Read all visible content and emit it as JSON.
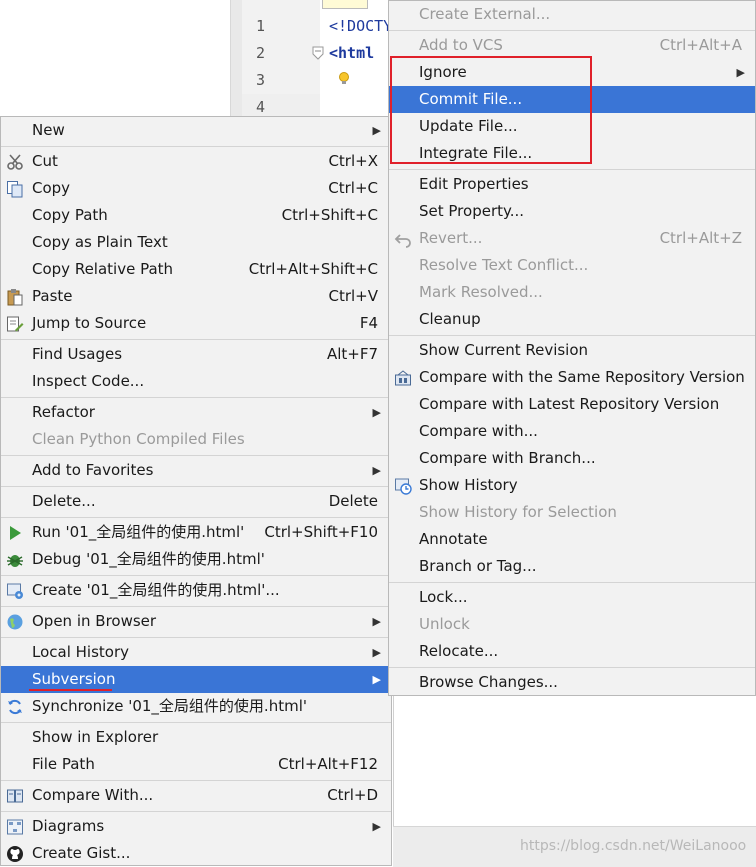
{
  "editor": {
    "line_numbers": [
      "1",
      "2",
      "3",
      "4"
    ],
    "code_lines": [
      "<!DOCTY",
      "<html"
    ]
  },
  "left_menu": {
    "new": "New",
    "cut": {
      "label": "Cut",
      "shortcut": "Ctrl+X"
    },
    "copy": {
      "label": "Copy",
      "shortcut": "Ctrl+C"
    },
    "copy_path": {
      "label": "Copy Path",
      "shortcut": "Ctrl+Shift+C"
    },
    "copy_plain": {
      "label": "Copy as Plain Text"
    },
    "copy_relative": {
      "label": "Copy Relative Path",
      "shortcut": "Ctrl+Alt+Shift+C"
    },
    "paste": {
      "label": "Paste",
      "shortcut": "Ctrl+V"
    },
    "jump": {
      "label": "Jump to Source",
      "shortcut": "F4"
    },
    "find_usages": {
      "label": "Find Usages",
      "shortcut": "Alt+F7"
    },
    "inspect": {
      "label": "Inspect Code..."
    },
    "refactor": {
      "label": "Refactor"
    },
    "clean_python": {
      "label": "Clean Python Compiled Files"
    },
    "favorites": {
      "label": "Add to Favorites"
    },
    "delete": {
      "label": "Delete...",
      "shortcut": "Delete"
    },
    "run": {
      "label": "Run '01_全局组件的使用.html'",
      "shortcut": "Ctrl+Shift+F10"
    },
    "debug": {
      "label": "Debug '01_全局组件的使用.html'"
    },
    "create": {
      "label": "Create '01_全局组件的使用.html'..."
    },
    "open_browser": {
      "label": "Open in Browser"
    },
    "local_history": {
      "label": "Local History"
    },
    "subversion": {
      "label": "Subversion"
    },
    "synchronize": {
      "label": "Synchronize '01_全局组件的使用.html'"
    },
    "show_explorer": {
      "label": "Show in Explorer"
    },
    "file_path": {
      "label": "File Path",
      "shortcut": "Ctrl+Alt+F12"
    },
    "compare_with": {
      "label": "Compare With...",
      "shortcut": "Ctrl+D"
    },
    "diagrams": {
      "label": "Diagrams"
    },
    "create_gist": {
      "label": "Create Gist..."
    }
  },
  "right_menu": {
    "create_external": {
      "label": "Create External..."
    },
    "add_vcs": {
      "label": "Add to VCS",
      "shortcut": "Ctrl+Alt+A"
    },
    "ignore": {
      "label": "Ignore"
    },
    "commit": {
      "label": "Commit File..."
    },
    "update": {
      "label": "Update File..."
    },
    "integrate": {
      "label": "Integrate File..."
    },
    "edit_props": {
      "label": "Edit Properties"
    },
    "set_prop": {
      "label": "Set Property..."
    },
    "revert": {
      "label": "Revert...",
      "shortcut": "Ctrl+Alt+Z"
    },
    "resolve": {
      "label": "Resolve Text Conflict..."
    },
    "mark_resolved": {
      "label": "Mark Resolved..."
    },
    "cleanup": {
      "label": "Cleanup"
    },
    "show_current": {
      "label": "Show Current Revision"
    },
    "compare_same": {
      "label": "Compare with the Same Repository Version"
    },
    "compare_latest": {
      "label": "Compare with Latest Repository Version"
    },
    "compare_with": {
      "label": "Compare with..."
    },
    "compare_branch": {
      "label": "Compare with Branch..."
    },
    "show_history": {
      "label": "Show History"
    },
    "show_history_sel": {
      "label": "Show History for Selection"
    },
    "annotate": {
      "label": "Annotate"
    },
    "branch_tag": {
      "label": "Branch or Tag..."
    },
    "lock": {
      "label": "Lock..."
    },
    "unlock": {
      "label": "Unlock"
    },
    "relocate": {
      "label": "Relocate..."
    },
    "browse_changes": {
      "label": "Browse Changes..."
    }
  },
  "watermark": "https://blog.csdn.net/WeiLanooo",
  "colors": {
    "selection": "#3a75d6",
    "annotation": "#e0202a"
  }
}
